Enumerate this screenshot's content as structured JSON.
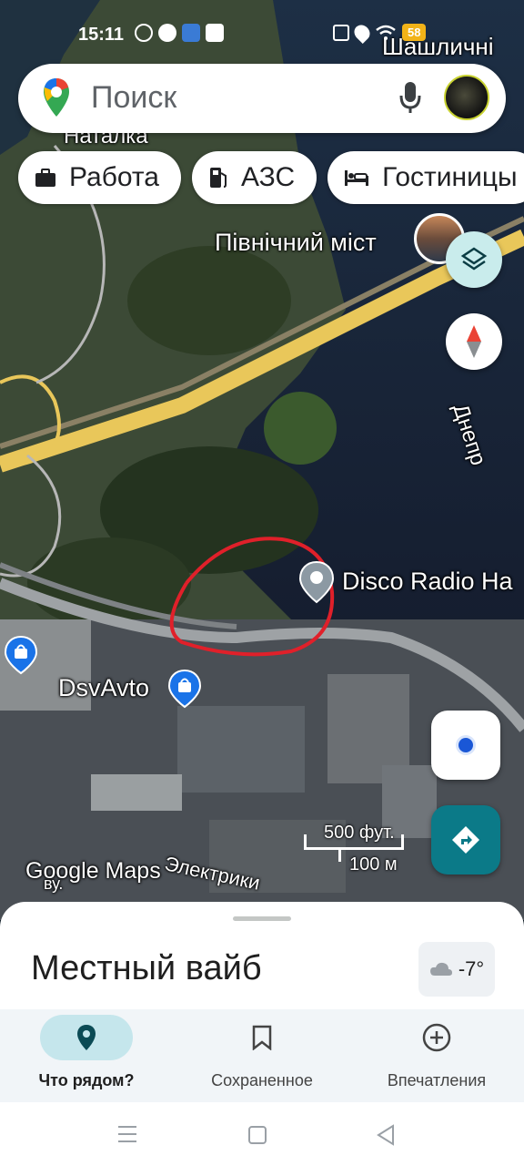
{
  "status_bar": {
    "time": "15:11",
    "battery": "58"
  },
  "search": {
    "placeholder": "Поиск"
  },
  "chips": [
    {
      "label": "Работа",
      "icon": "briefcase-icon"
    },
    {
      "label": "АЗС",
      "icon": "gas-station-icon"
    },
    {
      "label": "Гостиницы",
      "icon": "bed-icon"
    }
  ],
  "map": {
    "labels": {
      "top_right_place": "Шашличні",
      "top_left_place": "Наталка",
      "bridge": "Північний міст",
      "river": "Днепр",
      "venue": "Disco Radio Ha",
      "shop": "DsvAvto",
      "street": "Электрики",
      "street_prefix": "ву.",
      "watermark": "Google Maps"
    },
    "scale": {
      "imperial": "500 фут.",
      "metric": "100 м"
    }
  },
  "bottom_sheet": {
    "title": "Местный вайб",
    "temperature": "-7°"
  },
  "bottom_nav": [
    {
      "label": "Что рядом?",
      "icon": "location-pin-icon",
      "active": true
    },
    {
      "label": "Сохраненное",
      "icon": "bookmark-icon",
      "active": false
    },
    {
      "label": "Впечатления",
      "icon": "add-circle-icon",
      "active": false
    }
  ],
  "colors": {
    "accent_teal": "#0b7a88",
    "active_nav_pill": "#c5e6ec",
    "highlight_circle": "#e0202a",
    "road_yellow": "#e9c75a"
  }
}
